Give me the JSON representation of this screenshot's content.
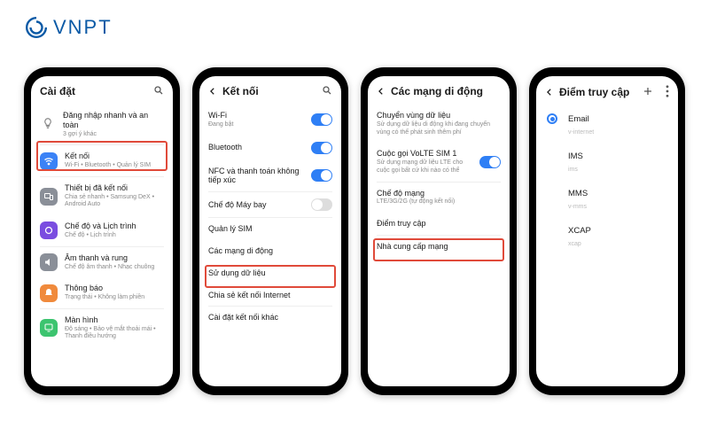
{
  "brand": {
    "name": "VNPT"
  },
  "phone1": {
    "title": "Cài đặt",
    "tip": {
      "title": "Đăng nhập nhanh và an toàn",
      "subtitle": "3 gợi ý khác"
    },
    "items": [
      {
        "icon_bg": "#3a82f6",
        "glyph": "wifi",
        "title": "Kết nối",
        "subtitle": "Wi-Fi • Bluetooth • Quản lý SIM"
      },
      {
        "icon_bg": "#8a8f98",
        "glyph": "devices",
        "title": "Thiết bị đã kết nối",
        "subtitle": "Chia sẻ nhanh • Samsung DeX • Android Auto"
      },
      {
        "icon_bg": "#7a4de0",
        "glyph": "mode",
        "title": "Chế độ và Lịch trình",
        "subtitle": "Chế độ • Lịch trình"
      },
      {
        "icon_bg": "#8a8f98",
        "glyph": "sound",
        "title": "Âm thanh và rung",
        "subtitle": "Chế độ âm thanh • Nhạc chuông"
      },
      {
        "icon_bg": "#f08a3c",
        "glyph": "bell",
        "title": "Thông báo",
        "subtitle": "Trạng thái • Không làm phiền"
      },
      {
        "icon_bg": "#3cc46f",
        "glyph": "display",
        "title": "Màn hình",
        "subtitle": "Độ sáng • Bảo vệ mắt thoải mái • Thanh điều hướng"
      }
    ]
  },
  "phone2": {
    "title": "Kết nối",
    "items": [
      {
        "title": "Wi-Fi",
        "subtitle": "Đang bật",
        "toggle": true
      },
      {
        "title": "Bluetooth",
        "toggle": true
      },
      {
        "title": "NFC và thanh toán không tiếp xúc",
        "toggle": true
      },
      {
        "title": "Chế độ Máy bay",
        "toggle": false
      },
      {
        "title": "Quản lý SIM"
      },
      {
        "title": "Các mạng di động"
      },
      {
        "title": "Sử dụng dữ liệu"
      },
      {
        "title": "Chia sẻ kết nối Internet"
      },
      {
        "title": "Cài đặt kết nối khác"
      }
    ]
  },
  "phone3": {
    "title": "Các mạng di động",
    "items": [
      {
        "title": "Chuyển vùng dữ liệu",
        "subtitle": "Sử dụng dữ liệu di động khi đang chuyển vùng có thể phát sinh thêm phí"
      },
      {
        "title": "Cuộc gọi VoLTE SIM 1",
        "subtitle": "Sử dụng mạng dữ liệu LTE cho cuộc gọi bất cứ khi nào có thể",
        "toggle": true
      },
      {
        "title": "Chế độ mạng",
        "subtitle": "LTE/3G/2G (tự động kết nối)"
      },
      {
        "title": "Điểm truy cập"
      },
      {
        "title": "Nhà cung cấp mạng"
      }
    ]
  },
  "phone4": {
    "title": "Điểm truy cập",
    "items": [
      {
        "name": "Email",
        "apn": "v-internet",
        "selected": true
      },
      {
        "name": "IMS",
        "apn": "ims"
      },
      {
        "name": "MMS",
        "apn": "v-mms"
      },
      {
        "name": "XCAP",
        "apn": "xcap"
      }
    ]
  }
}
